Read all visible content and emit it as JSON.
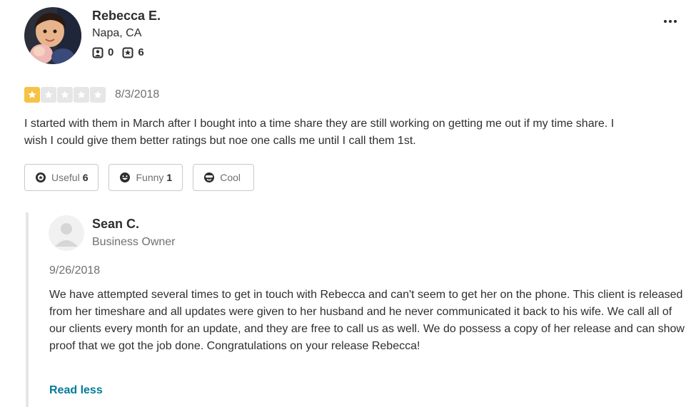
{
  "review": {
    "reviewer": {
      "name": "Rebecca E.",
      "location": "Napa, CA",
      "friends_count": "0",
      "reviews_count": "6",
      "friends_icon": "friends-icon",
      "reviews_icon": "review-star-icon"
    },
    "more_icon": "more-options-icon",
    "rating": 1,
    "rating_max": 5,
    "date": "8/3/2018",
    "text": "I started with them in March after I bought into a time share they are still working on getting me out if my time share. I wish I could give them better ratings but noe one calls me until I call them 1st.",
    "reactions": [
      {
        "label": "Useful",
        "count": "6",
        "icon": "useful-icon"
      },
      {
        "label": "Funny",
        "count": "1",
        "icon": "funny-icon"
      },
      {
        "label": "Cool",
        "count": "",
        "icon": "cool-icon"
      }
    ]
  },
  "reply": {
    "owner_name": "Sean C.",
    "owner_role": "Business Owner",
    "date": "9/26/2018",
    "text": "We have attempted several times to get in touch with Rebecca and can't seem to get her on the phone. This client is released from her timeshare and all updates were given to her husband and he never communicated it back to his wife. We call all of our clients every month for an update, and they are free to call us as well. We do possess a copy of her release and can show proof that we got the job done. Congratulations on your release Rebecca!",
    "read_less_label": "Read less"
  },
  "colors": {
    "star_filled": "#f6c244",
    "star_empty": "#e6e6e6",
    "link": "#027a97",
    "text": "#2d2e2f",
    "muted": "#6e7072"
  }
}
